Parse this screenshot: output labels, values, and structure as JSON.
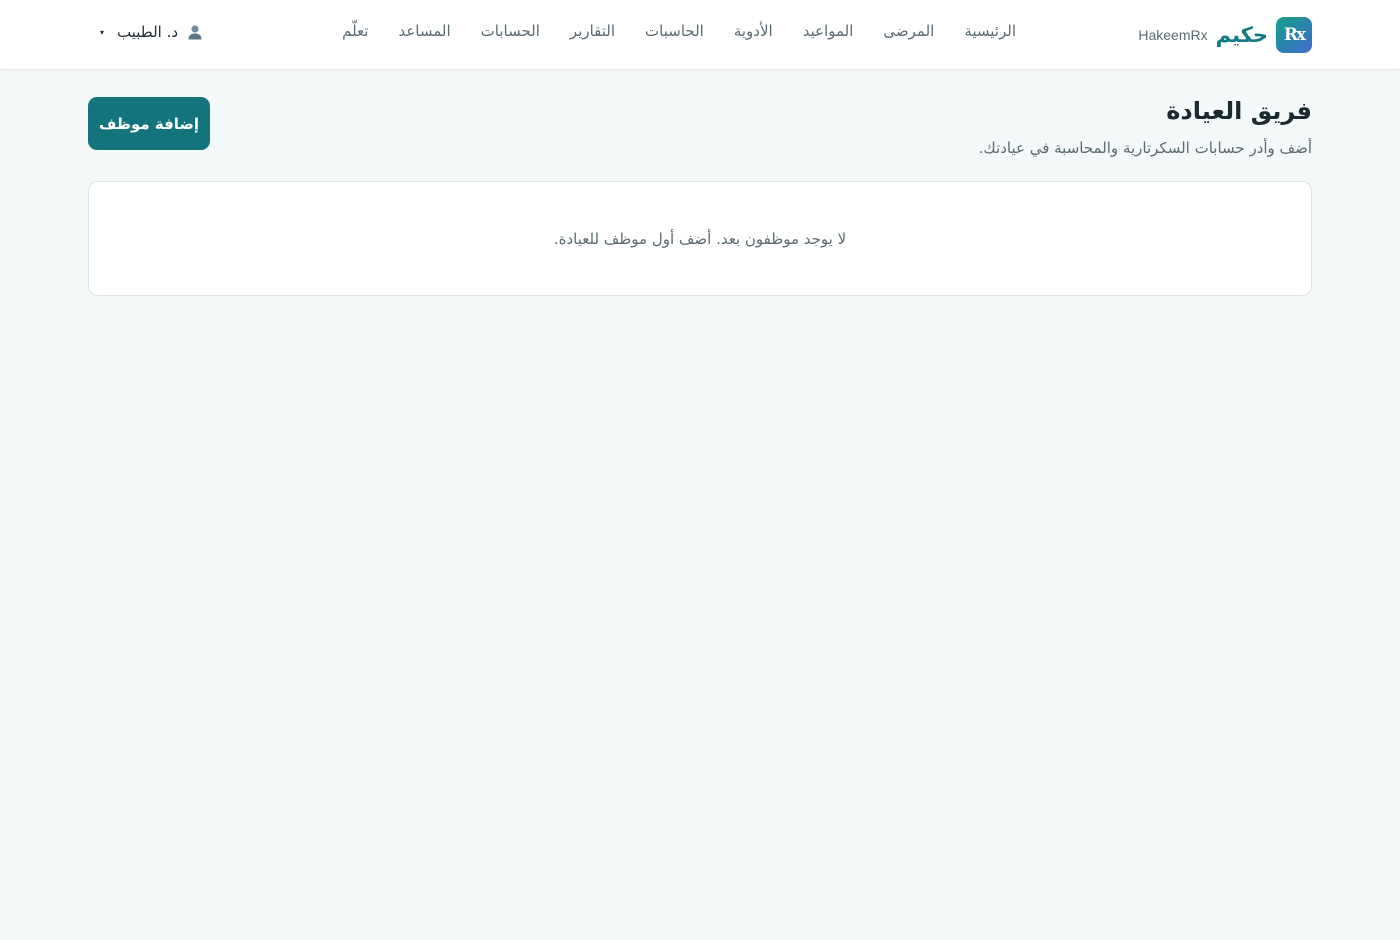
{
  "header": {
    "brand": {
      "logo_text": "Rx",
      "name_ar": "حكيم",
      "name_en": "HakeemRx",
      "logo_colors": [
        "#18a08a",
        "#2b7fb3",
        "#4a6ad0"
      ]
    },
    "nav": [
      {
        "label": "الرئيسية"
      },
      {
        "label": "المرضى"
      },
      {
        "label": "المواعيد"
      },
      {
        "label": "الأدوية"
      },
      {
        "label": "الحاسبات"
      },
      {
        "label": "التقارير"
      },
      {
        "label": "الحسابات"
      },
      {
        "label": "المساعد"
      },
      {
        "label": "تعلّم"
      }
    ],
    "user": {
      "name": "د. الطبيب",
      "icon": "user-icon",
      "caret": "▾"
    }
  },
  "main": {
    "title": "فريق العيادة",
    "subtitle": "أضف وأدر حسابات السكرتارية والمحاسبة في عيادتك.",
    "add_button_label": "إضافة موظف",
    "empty_state": "لا يوجد موظفون بعد. أضف أول موظف للعيادة."
  },
  "colors": {
    "accent": "#14747d",
    "brand_text": "#127a82",
    "background": "#f4f8f9"
  }
}
